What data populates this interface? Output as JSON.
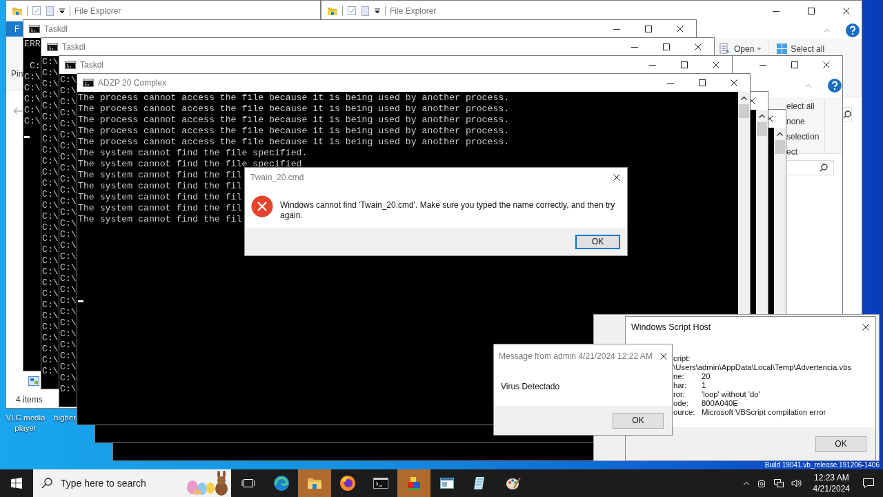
{
  "desktop": {
    "icons": [
      {
        "label": "VLC media player"
      },
      {
        "label": "higher"
      }
    ],
    "build_text": "Build 19041.vb_release.191206-1406"
  },
  "explorers": [
    {
      "title": "File Explorer",
      "file_tab": "F",
      "ribbon_label": "Pin",
      "status": "4 items"
    },
    {
      "title": "File Explorer",
      "ribbon_buttons": [
        "Open",
        "Select all"
      ]
    },
    {
      "ribbon_items": [
        "elect all",
        "none",
        "selection",
        "ect"
      ]
    }
  ],
  "consoles": [
    {
      "title": "Taskdl",
      "header": "ERR",
      "lines": [
        " C:",
        "C:\\",
        "C:\\",
        "C:\\",
        "C:\\",
        "C:\\"
      ],
      "cursor": true
    },
    {
      "title": "Taskdl",
      "lines": [
        "C:\\",
        "C:\\",
        "C:\\",
        "C:\\",
        "C:\\",
        "C:\\",
        "C:\\",
        "C:\\",
        "C:\\",
        "C:\\",
        "C:\\",
        "C:\\",
        "C:\\",
        "C:\\",
        "C:\\",
        "C:\\",
        "C:\\",
        "C:\\",
        "C:\\",
        "C:\\",
        "C:\\",
        "C:\\",
        "C:\\",
        "C:\\",
        "C:\\",
        "C:\\",
        "C:\\",
        "C:\\",
        "C:\\"
      ],
      "cursor": false
    },
    {
      "title": "Taskdl",
      "lines": [
        "C:\\",
        "C:\\",
        "C:\\",
        "C:\\",
        "C:\\",
        "C:\\",
        "C:\\",
        "C:\\",
        "C:\\",
        "C:\\",
        "C:\\",
        "C:\\",
        "C:\\",
        "C:\\",
        "C:\\",
        "C:\\",
        "C:\\",
        "C:\\",
        "C:\\",
        "C:\\",
        "C:\\",
        "C:\\",
        "C:\\",
        "C:\\",
        "C:\\",
        "C:\\",
        "C:\\",
        "C:\\",
        "C:\\"
      ],
      "cursor": false
    },
    {
      "title": "ADZP 20 Complex",
      "lines": [
        "The process cannot access the file because it is being used by another process.",
        "The process cannot access the file because it is being used by another process.",
        "The process cannot access the file because it is being used by another process.",
        "The process cannot access the file because it is being used by another process.",
        "The process cannot access the file because it is being used by another process.",
        "The system cannot find the file specified.",
        "The system cannot find the file specified",
        "The system cannot find the fil",
        "The system cannot find the fil",
        "The system cannot find the fil",
        "The system cannot find the fil",
        "The system cannot find the fil"
      ],
      "cursor": true
    }
  ],
  "error_dialog": {
    "title": "Twain_20.cmd",
    "message": "Windows cannot find 'Twain_20.cmd'. Make sure you typed the name correctly, and then try again.",
    "button": {
      "label": "OK",
      "focused": true
    }
  },
  "message_box": {
    "title": "Message from admin 4/21/2024 12:22 AM",
    "message": "Virus Detectado",
    "button": {
      "label": "OK",
      "focused": false
    }
  },
  "script_host": {
    "title": "Windows Script Host",
    "rows": [
      {
        "label": "cript:"
      },
      {
        "value": "\\Users\\admin\\AppData\\Local\\Temp\\Advertencia.vbs"
      },
      {
        "label": "ne:",
        "value": "20"
      },
      {
        "label": "har:",
        "value": "1"
      },
      {
        "label": "ror:",
        "value": "'loop' without 'do'"
      },
      {
        "label": "ode:",
        "value": "800A040E"
      },
      {
        "label": "ource:",
        "value": "Microsoft VBScript compilation error"
      }
    ],
    "button": {
      "label": "OK",
      "focused": false
    }
  },
  "taskbar": {
    "search": {
      "placeholder": "Type here to search"
    },
    "apps": [
      {
        "kind": "swirl",
        "flashing": false
      },
      {
        "kind": "folder",
        "flashing": true
      },
      {
        "kind": "flame",
        "flashing": false
      },
      {
        "kind": "console",
        "flashing": false
      },
      {
        "kind": "blocks",
        "flashing": true
      },
      {
        "kind": "panel",
        "flashing": false
      },
      {
        "kind": "pen",
        "flashing": false
      },
      {
        "kind": "palette",
        "flashing": false
      }
    ],
    "clock": {
      "time": "12:23 AM",
      "date": "4/21/2024"
    }
  }
}
